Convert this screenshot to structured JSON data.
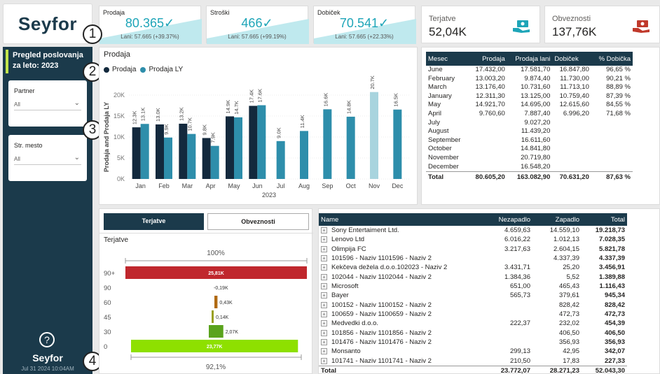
{
  "logo": "Seyfor",
  "kpis": [
    {
      "title": "Prodaja",
      "value": "80.365",
      "sub": "Lani: 57.665 (+39.37%)"
    },
    {
      "title": "Stroški",
      "value": "466",
      "sub": "Lani: 57.665 (+99.19%)"
    },
    {
      "title": "Dobiček",
      "value": "70.541",
      "sub": "Lani: 57.665 (+22.33%)"
    }
  ],
  "check_mark": "✓",
  "cards": [
    {
      "title": "Terjatve",
      "value": "52,04K",
      "icon": "money-hand-icon",
      "color": "#1ea5b8"
    },
    {
      "title": "Obveznosti",
      "value": "137,76K",
      "icon": "money-hand-icon",
      "color": "#c0392b"
    }
  ],
  "sidebar": {
    "title": "Pregled poslovanja za leto: 2023",
    "slicers": [
      {
        "label": "Partner",
        "value": "All"
      },
      {
        "label": "Str. mesto",
        "value": "All"
      }
    ],
    "help": "?",
    "logo": "Seyfor",
    "date": "Jul 31 2024 10:04AM"
  },
  "markers": [
    "1",
    "2",
    "3",
    "4"
  ],
  "chart_data": {
    "type": "bar",
    "title": "Prodaja",
    "xlabel": "2023",
    "ylabel": "Prodaja and Prodaja LY",
    "ylim": [
      0,
      20000
    ],
    "yticks": [
      "0K",
      "5K",
      "10K",
      "15K",
      "20K"
    ],
    "ytick_values": [
      0,
      5000,
      10000,
      15000,
      20000
    ],
    "categories": [
      "Jan",
      "Feb",
      "Mar",
      "Apr",
      "May",
      "Jun",
      "Jul",
      "Aug",
      "Sep",
      "Oct",
      "Nov",
      "Dec"
    ],
    "series": [
      {
        "name": "Prodaja",
        "color": "#13293d",
        "values": [
          12311.3,
          13003.2,
          13176.4,
          9760.6,
          14921.7,
          17432.0,
          null,
          null,
          null,
          null,
          null,
          null
        ],
        "labels": [
          "12.3K",
          "13.0K",
          "13.2K",
          "9.8K",
          "14.9K",
          "17.4K",
          "",
          "",
          "",
          "",
          "",
          ""
        ]
      },
      {
        "name": "Prodaja LY",
        "color": "#2e8eab",
        "values": [
          13125.0,
          9874.4,
          10731.6,
          7887.4,
          14695.0,
          17581.7,
          9027.2,
          11439.2,
          16611.6,
          14841.8,
          20719.8,
          16548.2
        ],
        "labels": [
          "13.1K",
          "9.9K",
          "10.7K",
          "7.9K",
          "14.7K",
          "17.6K",
          "9.0K",
          "11.4K",
          "16.6K",
          "14.8K",
          "20.7K",
          "16.5K"
        ]
      }
    ],
    "legend": "top-left",
    "grid": true
  },
  "sales_table": {
    "headers": [
      "Mesec",
      "Prodaja",
      "Prodaja lani",
      "Dobiček",
      "% Dobička"
    ],
    "rows": [
      [
        "June",
        "17.432,00",
        "17.581,70",
        "16.847,80",
        "96,65 %"
      ],
      [
        "February",
        "13.003,20",
        "9.874,40",
        "11.730,00",
        "90,21 %"
      ],
      [
        "March",
        "13.176,40",
        "10.731,60",
        "11.713,10",
        "88,89 %"
      ],
      [
        "January",
        "12.311,30",
        "13.125,00",
        "10.759,40",
        "87,39 %"
      ],
      [
        "May",
        "14.921,70",
        "14.695,00",
        "12.615,60",
        "84,55 %"
      ],
      [
        "April",
        "9.760,60",
        "7.887,40",
        "6.996,20",
        "71,68 %"
      ],
      [
        "July",
        "",
        "9.027,20",
        "",
        ""
      ],
      [
        "August",
        "",
        "11.439,20",
        "",
        ""
      ],
      [
        "September",
        "",
        "16.611,60",
        "",
        ""
      ],
      [
        "October",
        "",
        "14.841,80",
        "",
        ""
      ],
      [
        "November",
        "",
        "20.719,80",
        "",
        ""
      ],
      [
        "December",
        "",
        "16.548,20",
        "",
        ""
      ]
    ],
    "total": [
      "Total",
      "80.605,20",
      "163.082,90",
      "70.631,20",
      "87,63 %"
    ]
  },
  "tabs": [
    "Terjatve",
    "Obveznosti"
  ],
  "aging": {
    "title": "Terjatve",
    "top_label": "100%",
    "bottom_label": "92,1%",
    "rows": [
      {
        "label": "90+",
        "value": "25,81K",
        "fraction": 1.0,
        "color": "#c0272d"
      },
      {
        "label": "90",
        "value": "-0,19K",
        "fraction": 0.0,
        "color": "#666666"
      },
      {
        "label": "60",
        "value": "0,43K",
        "fraction": 0.017,
        "color": "#b06a12"
      },
      {
        "label": "45",
        "value": "0,14K",
        "fraction": 0.005,
        "color": "#9aa021"
      },
      {
        "label": "30",
        "value": "2,07K",
        "fraction": 0.08,
        "color": "#5aa31c"
      },
      {
        "label": "0",
        "value": "23,77K",
        "fraction": 0.92,
        "color": "#8ee000"
      }
    ]
  },
  "partners": {
    "headers": [
      "Name",
      "Nezapadlo",
      "Zapadlo",
      "Total"
    ],
    "rows": [
      [
        "Sony Entertaiment Ltd.",
        "4.659,63",
        "14.559,10",
        "19.218,73"
      ],
      [
        "Lenovo Ltd",
        "6.016,22",
        "1.012,13",
        "7.028,35"
      ],
      [
        "Olimpija FC",
        "3.217,63",
        "2.604,15",
        "5.821,78"
      ],
      [
        "101596 - Naziv 1101596 - Naziv 2",
        "",
        "4.337,39",
        "4.337,39"
      ],
      [
        "Kekčeva dežela d.o.o.102023 - Naziv 2",
        "3.431,71",
        "25,20",
        "3.456,91"
      ],
      [
        "102044 - Naziv 1102044 - Naziv 2",
        "1.384,36",
        "5,52",
        "1.389,88"
      ],
      [
        "Microsoft",
        "651,00",
        "465,43",
        "1.116,43"
      ],
      [
        "Bayer",
        "565,73",
        "379,61",
        "945,34"
      ],
      [
        "100152 - Naziv 1100152 - Naziv 2",
        "",
        "828,42",
        "828,42"
      ],
      [
        "100659 - Naziv 1100659 - Naziv 2",
        "",
        "472,73",
        "472,73"
      ],
      [
        "Medvedki d.o.o.",
        "222,37",
        "232,02",
        "454,39"
      ],
      [
        "101856 - Naziv 1101856 - Naziv 2",
        "",
        "406,50",
        "406,50"
      ],
      [
        "101476 - Naziv 1101476 - Naziv 2",
        "",
        "356,93",
        "356,93"
      ],
      [
        "Monsanto",
        "299,13",
        "42,95",
        "342,07"
      ],
      [
        "101741 - Naziv 1101741 - Naziv 2",
        "210,50",
        "17,83",
        "227,33"
      ]
    ],
    "total": [
      "Total",
      "23.772,07",
      "28.271,23",
      "52.043,30"
    ]
  }
}
